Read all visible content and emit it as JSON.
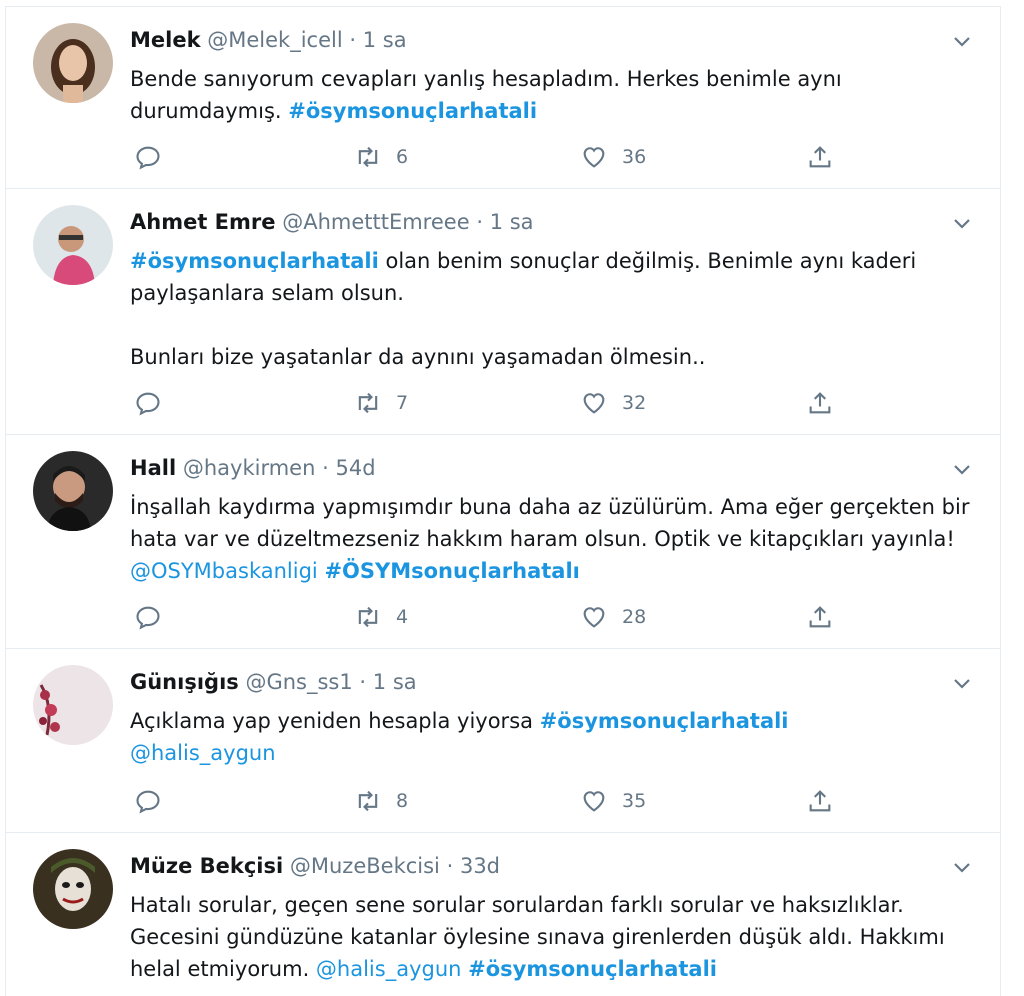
{
  "tweets": [
    {
      "name": "Melek",
      "handle": "@Melek_icell",
      "dot": "·",
      "time": "1 sa",
      "lines": [
        [
          "Bende sanıyorum cevapları yanlış hesapladım.  Herkes benimle aynı durumdaymış. ",
          "#ösymsonuçlarhatali"
        ]
      ],
      "retweets": "6",
      "likes": "36"
    },
    {
      "name": "Ahmet Emre",
      "handle": "@AhmetttEmreee",
      "dot": "·",
      "time": "1 sa",
      "p1_hashtag": "#ösymsonuçlarhatali",
      "p1_text": " olan benim sonuçlar değilmiş. Benimle aynı kaderi paylaşanlara selam olsun.",
      "p2_text": "Bunları bize yaşatanlar da aynını yaşamadan ölmesin..",
      "retweets": "7",
      "likes": "32"
    },
    {
      "name": "Hall",
      "handle": "@haykirmen",
      "dot": "·",
      "time": "54d",
      "text": "İnşallah kaydırma yapmışımdır buna daha az üzülürüm. Ama eğer gerçekten bir hata var ve düzeltmezseniz hakkım haram olsun. Optik ve kitapçıkları yayınla! ",
      "mention": "@OSYMbaskanligi",
      "hashtag": "#ÖSYMsonuçlarhatalı",
      "retweets": "4",
      "likes": "28"
    },
    {
      "name": "Günışığıs",
      "handle": "@Gns_ss1",
      "dot": "·",
      "time": "1 sa",
      "text": "Açıklama yap yeniden hesapla yiyorsa  ",
      "hashtag": "#ösymsonuçlarhatali",
      "mention": "@halis_aygun",
      "retweets": "8",
      "likes": "35"
    },
    {
      "name": "Müze Bekçisi",
      "handle": "@MuzeBekcisi",
      "dot": "·",
      "time": "33d",
      "text": "Hatalı sorular, geçen sene sorular sorulardan farklı sorular ve haksızlıklar. Gecesini gündüzüne katanlar öylesine sınava girenlerden düşük aldı. Hakkımı helal etmiyorum. ",
      "mention": "@halis_aygun",
      "hashtag": "#ösymsonuçlarhatali"
    }
  ],
  "colors": {
    "link": "#1b95e0",
    "muted": "#657786",
    "text": "#14171a",
    "border": "#e6ecf0"
  },
  "icons": [
    "reply-icon",
    "retweet-icon",
    "like-icon",
    "share-icon",
    "chevron-down-icon"
  ]
}
